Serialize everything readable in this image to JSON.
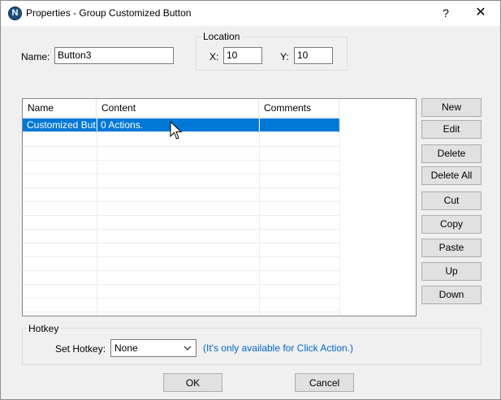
{
  "window": {
    "title": "Properties - Group Customized Button",
    "app_icon_letter": "N",
    "help_glyph": "?",
    "close_glyph": "✕"
  },
  "name_field": {
    "label": "Name:",
    "value": "Button3"
  },
  "location": {
    "legend": "Location",
    "x_label": "X:",
    "x_value": "10",
    "y_label": "Y:",
    "y_value": "10"
  },
  "grid": {
    "columns": [
      "Name",
      "Content",
      "Comments"
    ],
    "rows": [
      {
        "name": "Customized But...",
        "content": "0 Actions.",
        "comments": "",
        "selected": true
      }
    ]
  },
  "side_buttons": [
    "New",
    "Edit",
    "Delete",
    "Delete All",
    "Cut",
    "Copy",
    "Paste",
    "Up",
    "Down"
  ],
  "hotkey": {
    "legend": "Hotkey",
    "label": "Set Hotkey:",
    "value": "None",
    "hint": "(It's only available for Click Action.)"
  },
  "footer": {
    "ok_label": "OK",
    "cancel_label": "Cancel"
  },
  "colors": {
    "selection": "#0078d7",
    "hint": "#0066cc",
    "face": "#f0f0f0"
  },
  "icons": {
    "app": "app-logo-icon",
    "cursor": "mouse-pointer-icon",
    "dropdown": "chevron-down-icon"
  }
}
